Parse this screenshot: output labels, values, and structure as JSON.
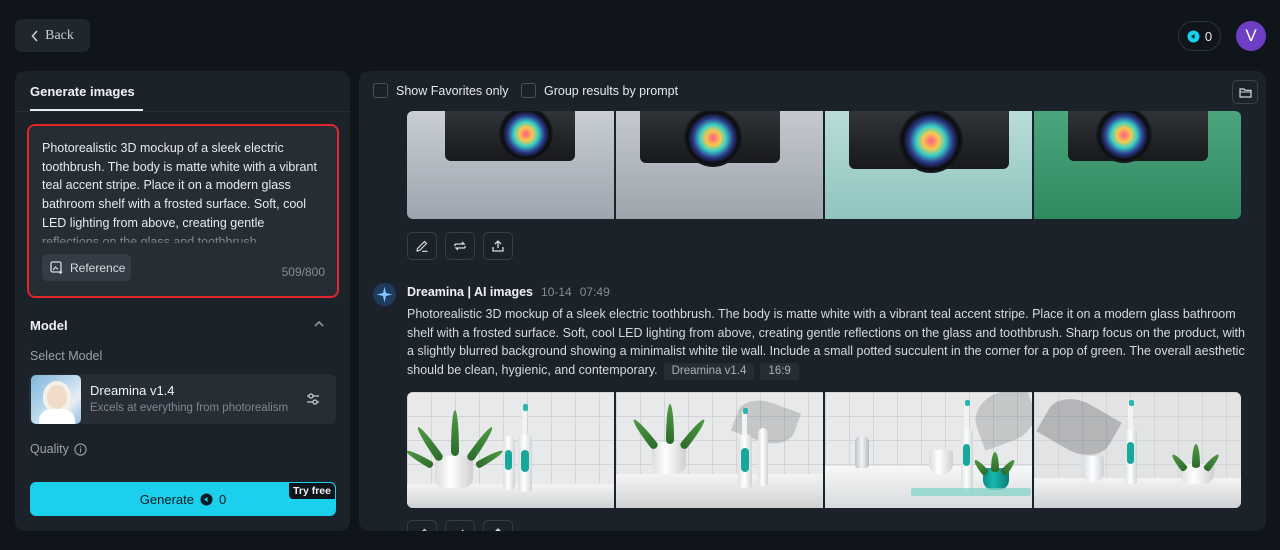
{
  "header": {
    "back_label": "Back",
    "credits": "0",
    "avatar_letter": "V"
  },
  "left_panel": {
    "tab_label": "Generate images",
    "prompt_text": "Photorealistic 3D mockup of a sleek electric toothbrush. The body is matte white with a vibrant teal accent stripe. Place it on a modern glass bathroom shelf with a frosted surface. Soft, cool LED lighting from above, creating gentle reflections on the glass and toothbrush",
    "reference_label": "Reference",
    "char_count": "509/800",
    "model_section_title": "Model",
    "select_model_label": "Select Model",
    "model_name": "Dreamina v1.4",
    "model_desc": "Excels at everything from photorealism",
    "quality_label": "Quality",
    "generate_label": "Generate",
    "generate_cost": "0",
    "try_free_label": "Try free"
  },
  "toolbar": {
    "show_favorites_label": "Show Favorites only",
    "group_results_label": "Group results by prompt"
  },
  "message": {
    "author": "Dreamina | AI images",
    "date": "10-14",
    "time": "07:49",
    "prompt": "Photorealistic 3D mockup of a sleek electric toothbrush. The body is matte white with a vibrant teal accent stripe. Place it on a modern glass bathroom shelf with a frosted surface. Soft, cool LED lighting from above, creating gentle reflections on the glass and toothbrush. Sharp focus on the product, with a slightly blurred background showing a minimalist white tile wall. Include a small potted succulent in the corner for a pop of green. The overall aesthetic should be clean, hygienic, and contemporary.",
    "model_tag": "Dreamina v1.4",
    "ratio_tag": "16:9"
  },
  "colors": {
    "accent": "#1ad0ec",
    "highlight_border": "#e0262b",
    "avatar": "#6c3fc5",
    "panel": "#1b2229",
    "background": "#0f151b"
  },
  "icons": [
    "chevron-left-icon",
    "credit-coin-icon",
    "reference-image-icon",
    "chevron-up-icon",
    "sliders-icon",
    "info-icon",
    "folder-icon",
    "edit-pencil-icon",
    "regenerate-icon",
    "upload-icon",
    "dreamina-logo-icon"
  ]
}
